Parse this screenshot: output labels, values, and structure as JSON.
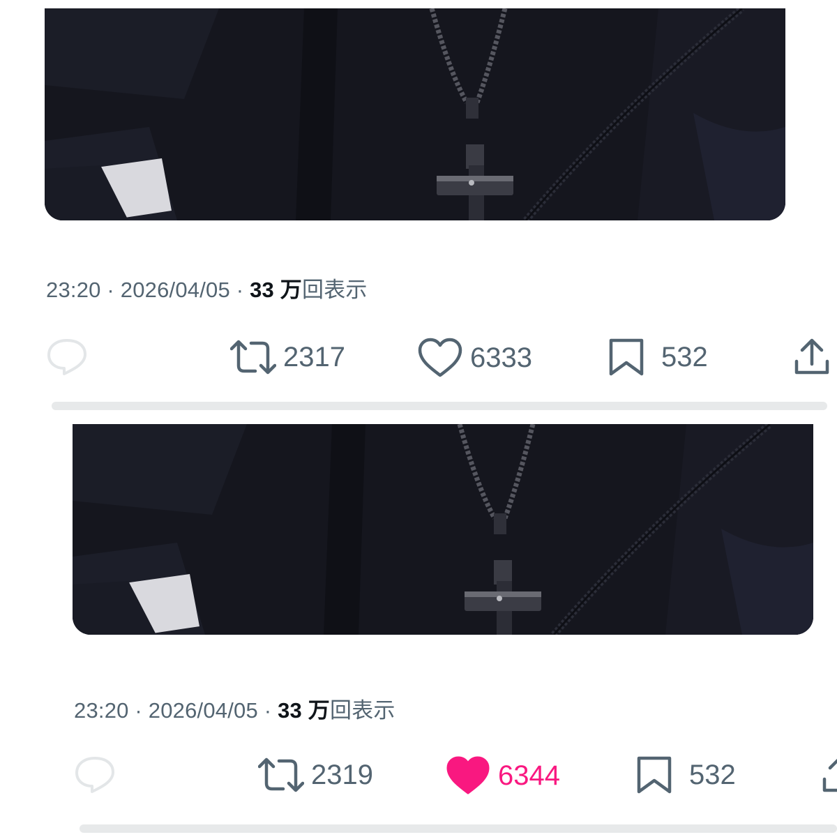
{
  "colors": {
    "text_secondary": "#536471",
    "text_primary": "#0f1419",
    "like_active": "#f91880",
    "media_background": "#15161e"
  },
  "posts": [
    {
      "time": "23:20",
      "separator": "·",
      "date": "2026/04/05",
      "views_number": "33 万",
      "views_suffix": "回表示",
      "actions": {
        "reply": {
          "icon": "reply-icon"
        },
        "repost": {
          "icon": "repost-icon",
          "count": "2317"
        },
        "like": {
          "icon": "heart-outline-icon",
          "count": "6333",
          "liked": false
        },
        "bookmark": {
          "icon": "bookmark-icon",
          "count": "532"
        },
        "share": {
          "icon": "share-icon"
        }
      }
    },
    {
      "time": "23:20",
      "separator": "·",
      "date": "2026/04/05",
      "views_number": "33 万",
      "views_suffix": "回表示",
      "actions": {
        "reply": {
          "icon": "reply-icon"
        },
        "repost": {
          "icon": "repost-icon",
          "count": "2319"
        },
        "like": {
          "icon": "heart-filled-icon",
          "count": "6344",
          "liked": true
        },
        "bookmark": {
          "icon": "bookmark-icon",
          "count": "532"
        },
        "share": {
          "icon": "share-icon"
        }
      }
    }
  ]
}
